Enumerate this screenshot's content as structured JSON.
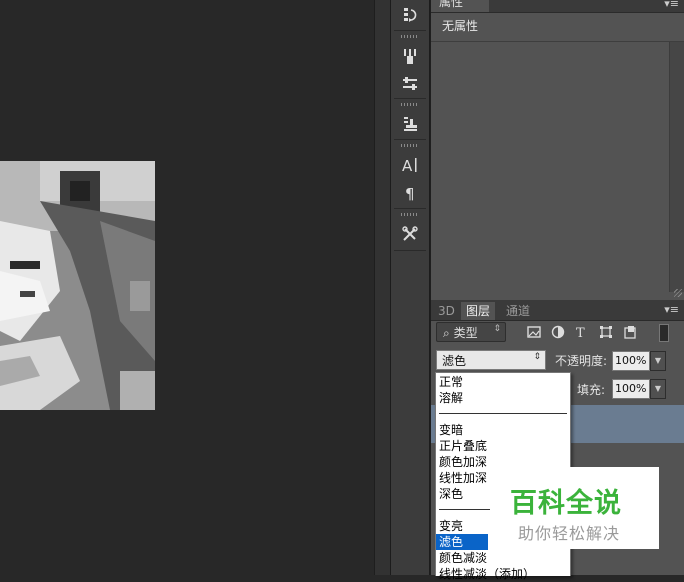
{
  "properties_panel": {
    "tab_label": "属性",
    "menu_icon": "panel-menu-icon",
    "empty_text": "无属性"
  },
  "tools": [
    {
      "name": "history-icon"
    },
    {
      "name": "brush-presets-icon"
    },
    {
      "name": "adjust-sliders-icon"
    },
    {
      "name": "clone-stamp-icon"
    },
    {
      "name": "character-icon"
    },
    {
      "name": "paragraph-icon"
    },
    {
      "name": "tool-presets-icon"
    }
  ],
  "layers_panel": {
    "tabs": [
      {
        "label": "3D",
        "active": false
      },
      {
        "label": "图层",
        "active": true
      },
      {
        "label": "通道",
        "active": false
      }
    ],
    "filter": {
      "search_glyph": "⌕",
      "kind_label": "类型",
      "icons": [
        "image-filter-icon",
        "adjustment-filter-icon",
        "type-filter-icon",
        "shape-filter-icon",
        "smart-object-filter-icon"
      ]
    },
    "blend_mode": "滤色",
    "opacity_label": "不透明度:",
    "opacity_value": "100%",
    "fill_label": "填充:",
    "fill_value": "100%"
  },
  "blend_dropdown": {
    "options": [
      {
        "label": "正常",
        "selected": false
      },
      {
        "label": "溶解",
        "selected": false
      },
      {
        "separator": true
      },
      {
        "label": "变暗",
        "selected": false
      },
      {
        "label": "正片叠底",
        "selected": false
      },
      {
        "label": "颜色加深",
        "selected": false
      },
      {
        "label": "线性加深",
        "selected": false
      },
      {
        "label": "深色",
        "selected": false
      },
      {
        "separator": true
      },
      {
        "label": "变亮",
        "selected": false
      },
      {
        "label": "滤色",
        "selected": true
      },
      {
        "label": "颜色减淡",
        "selected": false
      },
      {
        "label": "线性减淡（添加）",
        "selected": false
      }
    ]
  },
  "watermark": {
    "title": "百科全说",
    "subtitle": "助你轻松解决",
    "title_color": "#3bb33b"
  },
  "colors": {
    "selection_blue": "#0a64c8",
    "layer_highlight": "#6a7c91"
  }
}
